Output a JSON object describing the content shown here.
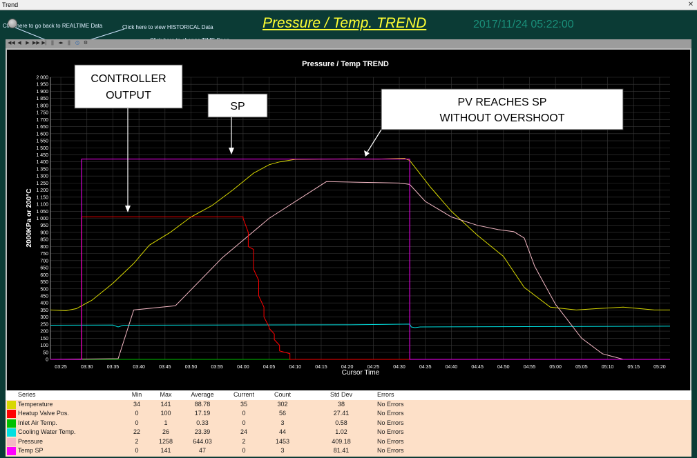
{
  "window": {
    "title": "Trend"
  },
  "header": {
    "hint_realtime": "Click here to go back to REALTIME Data",
    "hint_historical": "Click here to view HISTORICAL Data",
    "hint_timespan": "Click here to change TIME Span",
    "title": "Pressure / Temp. TREND",
    "timestamp": "2017/11/24 05:22:00"
  },
  "toolbar": {
    "buttons": [
      "rewind-fast",
      "rewind",
      "forward",
      "forward-fast",
      "end",
      "pause",
      "zoom",
      "clock",
      "settings"
    ]
  },
  "annotations": {
    "controller_output": [
      "CONTROLLER",
      "OUTPUT"
    ],
    "sp": "SP",
    "pv_reaches_sp": [
      "PV REACHES SP",
      "WITHOUT OVERSHOOT"
    ]
  },
  "colors": {
    "temperature": "#d8d800",
    "heatup_valve": "#ff0000",
    "inlet_air": "#00c000",
    "cooling_water": "#00e0e0",
    "pressure": "#f4b8c4",
    "temp_sp": "#ff00ff"
  },
  "chart_data": {
    "type": "line",
    "title": "Pressure / Temp TREND",
    "xlabel": "Cursor Time",
    "ylabel": "2000KPa or 200°C",
    "ylim": [
      0,
      2000
    ],
    "yticks": [
      0,
      50,
      100,
      150,
      200,
      250,
      300,
      350,
      400,
      450,
      500,
      550,
      600,
      650,
      700,
      750,
      800,
      850,
      900,
      950,
      1000,
      1050,
      1100,
      1150,
      1200,
      1250,
      1300,
      1350,
      1400,
      1450,
      1500,
      1550,
      1600,
      1650,
      1700,
      1750,
      1800,
      1850,
      1900,
      1950,
      2000
    ],
    "ytick_labels": [
      "0",
      "50",
      "100",
      "150",
      "200",
      "250",
      "300",
      "350",
      "400",
      "450",
      "500",
      "550",
      "600",
      "650",
      "700",
      "750",
      "800",
      "850",
      "900",
      "950",
      "1 000",
      "1 050",
      "1 100",
      "1 150",
      "1 200",
      "1 250",
      "1 300",
      "1 350",
      "1 400",
      "1 450",
      "1 500",
      "1 550",
      "1 600",
      "1 650",
      "1 700",
      "1 750",
      "1 800",
      "1 850",
      "1 900",
      "1 950",
      "2 000"
    ],
    "x_minutes_range": [
      23,
      322
    ],
    "xticks": [
      "03:25",
      "03:30",
      "03:35",
      "03:40",
      "03:45",
      "03:50",
      "03:55",
      "04:00",
      "04:05",
      "04:10",
      "04:15",
      "04:20",
      "04:25",
      "04:30",
      "04:35",
      "04:40",
      "04:45",
      "04:50",
      "04:55",
      "05:00",
      "05:05",
      "05:10",
      "05:15",
      "05:20"
    ],
    "xtick_minutes": [
      205,
      210,
      215,
      220,
      225,
      230,
      235,
      240,
      245,
      250,
      255,
      260,
      265,
      270,
      275,
      280,
      285,
      290,
      295,
      300,
      305,
      310,
      315,
      320
    ],
    "grid": true,
    "series": [
      {
        "name": "Temperature",
        "color_key": "temperature",
        "x": [
          203,
          206,
          208,
          211,
          215,
          219,
          222,
          226,
          230,
          234,
          238,
          242,
          245,
          247,
          250,
          255,
          261,
          266,
          271,
          272,
          276,
          280,
          285,
          290,
          294,
          299,
          304,
          308,
          313,
          319,
          322
        ],
        "y": [
          350,
          345,
          360,
          420,
          540,
          680,
          810,
          900,
          1010,
          1090,
          1200,
          1320,
          1380,
          1400,
          1418,
          1420,
          1421,
          1420,
          1425,
          1410,
          1220,
          1050,
          880,
          730,
          510,
          370,
          350,
          360,
          370,
          350,
          350
        ]
      },
      {
        "name": "Heatup Valve Pos.",
        "color_key": "heatup_valve",
        "x": [
          203,
          209,
          209,
          240,
          240,
          241,
          241,
          242,
          242,
          243,
          243,
          244,
          244,
          245,
          245,
          246,
          246,
          247,
          247,
          249,
          249,
          322
        ],
        "y": [
          0,
          0,
          1010,
          1010,
          1000,
          900,
          800,
          780,
          640,
          560,
          450,
          370,
          300,
          230,
          220,
          180,
          140,
          100,
          60,
          40,
          0,
          0
        ]
      },
      {
        "name": "Inlet Air Temp.",
        "color_key": "inlet_air",
        "x": [
          203,
          322
        ],
        "y": [
          0,
          0
        ]
      },
      {
        "name": "Cooling Water Temp.",
        "color_key": "cooling_water",
        "x": [
          203,
          215,
          216,
          217,
          260,
          272,
          272.3,
          273,
          274,
          322
        ],
        "y": [
          242,
          243,
          230,
          242,
          245,
          250,
          230,
          225,
          230,
          235
        ]
      },
      {
        "name": "Pressure",
        "color_key": "pressure",
        "x": [
          203,
          216,
          219,
          227,
          236,
          245,
          256,
          263,
          270,
          272,
          275,
          280,
          285,
          289,
          292,
          294,
          296,
          300,
          305,
          309,
          313,
          322
        ],
        "y": [
          0,
          5,
          350,
          380,
          720,
          1000,
          1260,
          1255,
          1250,
          1240,
          1120,
          1010,
          950,
          920,
          905,
          860,
          660,
          390,
          150,
          40,
          0,
          0
        ]
      },
      {
        "name": "Temp SP",
        "color_key": "temp_sp",
        "x": [
          203,
          209,
          209,
          272,
          272,
          322
        ],
        "y": [
          0,
          0,
          1420,
          1420,
          0,
          0
        ]
      }
    ]
  },
  "table": {
    "headers": [
      "Series",
      "Min",
      "Max",
      "Average",
      "Current",
      "Count",
      "Std Dev",
      "Errors"
    ],
    "rows": [
      {
        "series": "Temperature",
        "min": "34",
        "max": "141",
        "average": "88.78",
        "current": "35",
        "count": "302",
        "std_dev": "38",
        "errors": "No Errors",
        "color_key": "temperature"
      },
      {
        "series": "Heatup Valve Pos.",
        "min": "0",
        "max": "100",
        "average": "17.19",
        "current": "0",
        "count": "56",
        "std_dev": "27.41",
        "errors": "No Errors",
        "color_key": "heatup_valve"
      },
      {
        "series": "Inlet Air Temp.",
        "min": "0",
        "max": "1",
        "average": "0.33",
        "current": "0",
        "count": "3",
        "std_dev": "0.58",
        "errors": "No Errors",
        "color_key": "inlet_air"
      },
      {
        "series": "Cooling Water Temp.",
        "min": "22",
        "max": "26",
        "average": "23.39",
        "current": "24",
        "count": "44",
        "std_dev": "1.02",
        "errors": "No Errors",
        "color_key": "cooling_water"
      },
      {
        "series": "Pressure",
        "min": "2",
        "max": "1258",
        "average": "644.03",
        "current": "2",
        "count": "1453",
        "std_dev": "409.18",
        "errors": "No Errors",
        "color_key": "pressure"
      },
      {
        "series": "Temp SP",
        "min": "0",
        "max": "141",
        "average": "47",
        "current": "0",
        "count": "3",
        "std_dev": "81.41",
        "errors": "No Errors",
        "color_key": "temp_sp"
      }
    ]
  }
}
